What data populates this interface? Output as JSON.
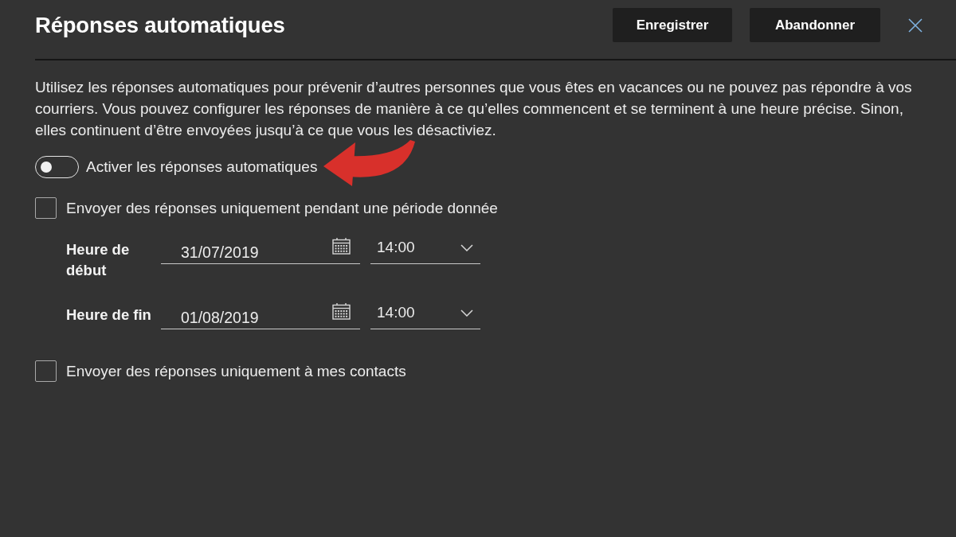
{
  "header": {
    "title": "Réponses automatiques",
    "buttons": [
      "Enregistrer",
      "Abandonner"
    ]
  },
  "description": "Utilisez les réponses automatiques pour prévenir d’autres personnes que vous êtes en vacances ou ne pouvez pas répondre à vos courriers. Vous pouvez configurer les réponses de manière à ce qu’elles commencent et se terminent à une heure précise. Sinon, elles continuent d’être envoyées jusqu’à ce que vous les désactiviez.",
  "auto_replies_toggle": {
    "label": "Activer les réponses automatiques",
    "on": false
  },
  "period_checkbox": {
    "label": "Envoyer des réponses uniquement pendant une période donnée",
    "checked": false
  },
  "schedule": [
    {
      "label": "Heure de début",
      "date": "31/07/2019",
      "time": "14:00"
    },
    {
      "label": "Heure de fin",
      "date": "01/08/2019",
      "time": "14:00"
    }
  ],
  "contacts_checkbox": {
    "label": "Envoyer des réponses uniquement à mes contacts",
    "checked": false
  }
}
